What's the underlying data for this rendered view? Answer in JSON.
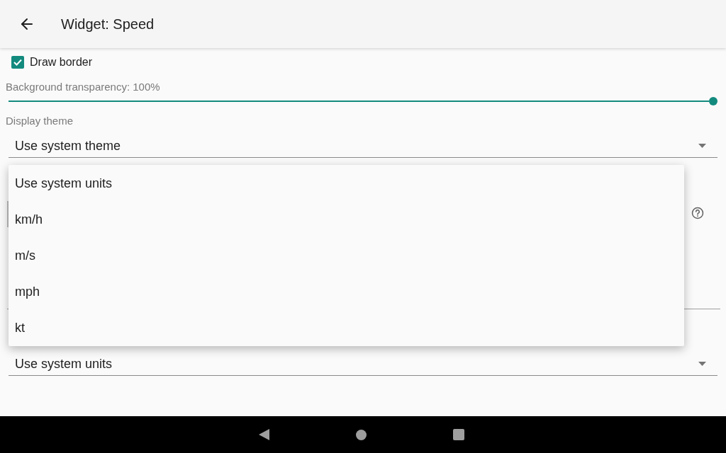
{
  "app_bar": {
    "title": "Widget: Speed"
  },
  "settings": {
    "draw_border": {
      "label": "Draw border",
      "checked": true
    },
    "transparency": {
      "label": "Background transparency: 100%",
      "level": 1
    },
    "display_theme": {
      "label": "Display theme",
      "value": "Use system theme"
    },
    "units": {
      "value": "Use system units"
    }
  },
  "units_menu": {
    "items": [
      {
        "label": "Use system units"
      },
      {
        "label": "km/h"
      },
      {
        "label": "m/s"
      },
      {
        "label": "mph"
      },
      {
        "label": "kt"
      }
    ]
  }
}
